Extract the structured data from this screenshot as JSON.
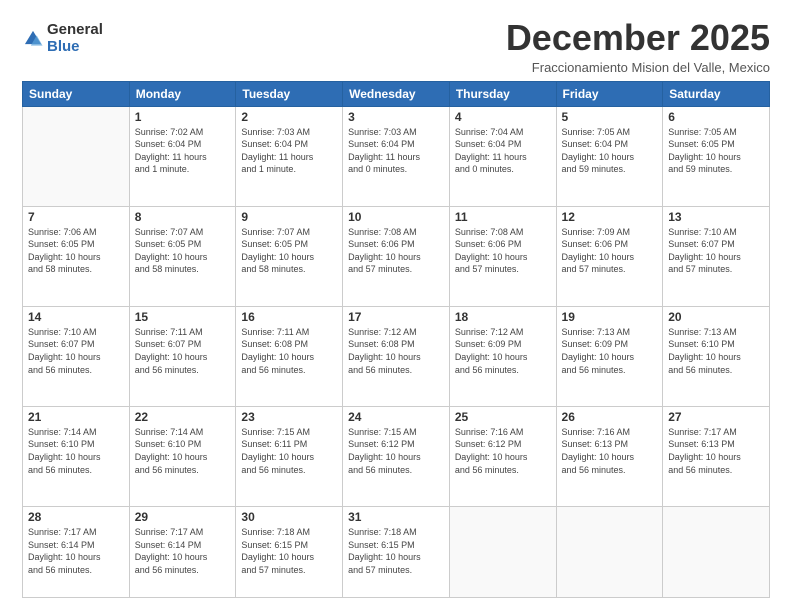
{
  "header": {
    "logo_general": "General",
    "logo_blue": "Blue",
    "month_title": "December 2025",
    "subtitle": "Fraccionamiento Mision del Valle, Mexico"
  },
  "weekdays": [
    "Sunday",
    "Monday",
    "Tuesday",
    "Wednesday",
    "Thursday",
    "Friday",
    "Saturday"
  ],
  "weeks": [
    [
      {
        "day": "",
        "info": ""
      },
      {
        "day": "1",
        "info": "Sunrise: 7:02 AM\nSunset: 6:04 PM\nDaylight: 11 hours\nand 1 minute."
      },
      {
        "day": "2",
        "info": "Sunrise: 7:03 AM\nSunset: 6:04 PM\nDaylight: 11 hours\nand 1 minute."
      },
      {
        "day": "3",
        "info": "Sunrise: 7:03 AM\nSunset: 6:04 PM\nDaylight: 11 hours\nand 0 minutes."
      },
      {
        "day": "4",
        "info": "Sunrise: 7:04 AM\nSunset: 6:04 PM\nDaylight: 11 hours\nand 0 minutes."
      },
      {
        "day": "5",
        "info": "Sunrise: 7:05 AM\nSunset: 6:04 PM\nDaylight: 10 hours\nand 59 minutes."
      },
      {
        "day": "6",
        "info": "Sunrise: 7:05 AM\nSunset: 6:05 PM\nDaylight: 10 hours\nand 59 minutes."
      }
    ],
    [
      {
        "day": "7",
        "info": "Sunrise: 7:06 AM\nSunset: 6:05 PM\nDaylight: 10 hours\nand 58 minutes."
      },
      {
        "day": "8",
        "info": "Sunrise: 7:07 AM\nSunset: 6:05 PM\nDaylight: 10 hours\nand 58 minutes."
      },
      {
        "day": "9",
        "info": "Sunrise: 7:07 AM\nSunset: 6:05 PM\nDaylight: 10 hours\nand 58 minutes."
      },
      {
        "day": "10",
        "info": "Sunrise: 7:08 AM\nSunset: 6:06 PM\nDaylight: 10 hours\nand 57 minutes."
      },
      {
        "day": "11",
        "info": "Sunrise: 7:08 AM\nSunset: 6:06 PM\nDaylight: 10 hours\nand 57 minutes."
      },
      {
        "day": "12",
        "info": "Sunrise: 7:09 AM\nSunset: 6:06 PM\nDaylight: 10 hours\nand 57 minutes."
      },
      {
        "day": "13",
        "info": "Sunrise: 7:10 AM\nSunset: 6:07 PM\nDaylight: 10 hours\nand 57 minutes."
      }
    ],
    [
      {
        "day": "14",
        "info": "Sunrise: 7:10 AM\nSunset: 6:07 PM\nDaylight: 10 hours\nand 56 minutes."
      },
      {
        "day": "15",
        "info": "Sunrise: 7:11 AM\nSunset: 6:07 PM\nDaylight: 10 hours\nand 56 minutes."
      },
      {
        "day": "16",
        "info": "Sunrise: 7:11 AM\nSunset: 6:08 PM\nDaylight: 10 hours\nand 56 minutes."
      },
      {
        "day": "17",
        "info": "Sunrise: 7:12 AM\nSunset: 6:08 PM\nDaylight: 10 hours\nand 56 minutes."
      },
      {
        "day": "18",
        "info": "Sunrise: 7:12 AM\nSunset: 6:09 PM\nDaylight: 10 hours\nand 56 minutes."
      },
      {
        "day": "19",
        "info": "Sunrise: 7:13 AM\nSunset: 6:09 PM\nDaylight: 10 hours\nand 56 minutes."
      },
      {
        "day": "20",
        "info": "Sunrise: 7:13 AM\nSunset: 6:10 PM\nDaylight: 10 hours\nand 56 minutes."
      }
    ],
    [
      {
        "day": "21",
        "info": "Sunrise: 7:14 AM\nSunset: 6:10 PM\nDaylight: 10 hours\nand 56 minutes."
      },
      {
        "day": "22",
        "info": "Sunrise: 7:14 AM\nSunset: 6:10 PM\nDaylight: 10 hours\nand 56 minutes."
      },
      {
        "day": "23",
        "info": "Sunrise: 7:15 AM\nSunset: 6:11 PM\nDaylight: 10 hours\nand 56 minutes."
      },
      {
        "day": "24",
        "info": "Sunrise: 7:15 AM\nSunset: 6:12 PM\nDaylight: 10 hours\nand 56 minutes."
      },
      {
        "day": "25",
        "info": "Sunrise: 7:16 AM\nSunset: 6:12 PM\nDaylight: 10 hours\nand 56 minutes."
      },
      {
        "day": "26",
        "info": "Sunrise: 7:16 AM\nSunset: 6:13 PM\nDaylight: 10 hours\nand 56 minutes."
      },
      {
        "day": "27",
        "info": "Sunrise: 7:17 AM\nSunset: 6:13 PM\nDaylight: 10 hours\nand 56 minutes."
      }
    ],
    [
      {
        "day": "28",
        "info": "Sunrise: 7:17 AM\nSunset: 6:14 PM\nDaylight: 10 hours\nand 56 minutes."
      },
      {
        "day": "29",
        "info": "Sunrise: 7:17 AM\nSunset: 6:14 PM\nDaylight: 10 hours\nand 56 minutes."
      },
      {
        "day": "30",
        "info": "Sunrise: 7:18 AM\nSunset: 6:15 PM\nDaylight: 10 hours\nand 57 minutes."
      },
      {
        "day": "31",
        "info": "Sunrise: 7:18 AM\nSunset: 6:15 PM\nDaylight: 10 hours\nand 57 minutes."
      },
      {
        "day": "",
        "info": ""
      },
      {
        "day": "",
        "info": ""
      },
      {
        "day": "",
        "info": ""
      }
    ]
  ]
}
